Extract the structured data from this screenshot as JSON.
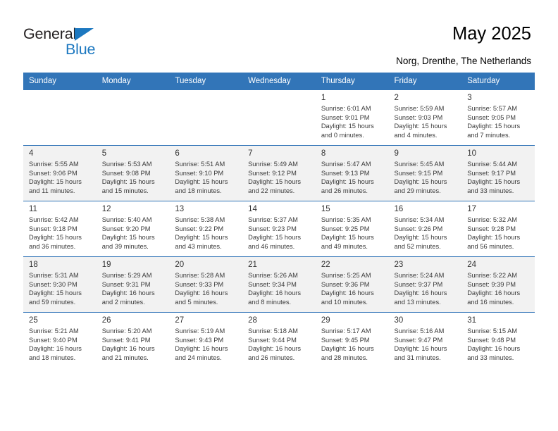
{
  "brand": {
    "name_top": "General",
    "name_bottom": "Blue",
    "accent_color": "#1c78c0"
  },
  "header": {
    "title": "May 2025",
    "subtitle": "Norg, Drenthe, The Netherlands"
  },
  "theme": {
    "header_row_bg": "#3275b8",
    "header_row_text": "#ffffff",
    "alt_row_bg": "#f2f2f2",
    "grid_line": "#3275b8"
  },
  "calendar": {
    "weekday_headers": [
      "Sunday",
      "Monday",
      "Tuesday",
      "Wednesday",
      "Thursday",
      "Friday",
      "Saturday"
    ],
    "weeks": [
      [
        {
          "day": "",
          "sunrise": "",
          "sunset": "",
          "daylight_line1": "",
          "daylight_line2": ""
        },
        {
          "day": "",
          "sunrise": "",
          "sunset": "",
          "daylight_line1": "",
          "daylight_line2": ""
        },
        {
          "day": "",
          "sunrise": "",
          "sunset": "",
          "daylight_line1": "",
          "daylight_line2": ""
        },
        {
          "day": "",
          "sunrise": "",
          "sunset": "",
          "daylight_line1": "",
          "daylight_line2": ""
        },
        {
          "day": "1",
          "sunrise": "Sunrise: 6:01 AM",
          "sunset": "Sunset: 9:01 PM",
          "daylight_line1": "Daylight: 15 hours",
          "daylight_line2": "and 0 minutes."
        },
        {
          "day": "2",
          "sunrise": "Sunrise: 5:59 AM",
          "sunset": "Sunset: 9:03 PM",
          "daylight_line1": "Daylight: 15 hours",
          "daylight_line2": "and 4 minutes."
        },
        {
          "day": "3",
          "sunrise": "Sunrise: 5:57 AM",
          "sunset": "Sunset: 9:05 PM",
          "daylight_line1": "Daylight: 15 hours",
          "daylight_line2": "and 7 minutes."
        }
      ],
      [
        {
          "day": "4",
          "sunrise": "Sunrise: 5:55 AM",
          "sunset": "Sunset: 9:06 PM",
          "daylight_line1": "Daylight: 15 hours",
          "daylight_line2": "and 11 minutes."
        },
        {
          "day": "5",
          "sunrise": "Sunrise: 5:53 AM",
          "sunset": "Sunset: 9:08 PM",
          "daylight_line1": "Daylight: 15 hours",
          "daylight_line2": "and 15 minutes."
        },
        {
          "day": "6",
          "sunrise": "Sunrise: 5:51 AM",
          "sunset": "Sunset: 9:10 PM",
          "daylight_line1": "Daylight: 15 hours",
          "daylight_line2": "and 18 minutes."
        },
        {
          "day": "7",
          "sunrise": "Sunrise: 5:49 AM",
          "sunset": "Sunset: 9:12 PM",
          "daylight_line1": "Daylight: 15 hours",
          "daylight_line2": "and 22 minutes."
        },
        {
          "day": "8",
          "sunrise": "Sunrise: 5:47 AM",
          "sunset": "Sunset: 9:13 PM",
          "daylight_line1": "Daylight: 15 hours",
          "daylight_line2": "and 26 minutes."
        },
        {
          "day": "9",
          "sunrise": "Sunrise: 5:45 AM",
          "sunset": "Sunset: 9:15 PM",
          "daylight_line1": "Daylight: 15 hours",
          "daylight_line2": "and 29 minutes."
        },
        {
          "day": "10",
          "sunrise": "Sunrise: 5:44 AM",
          "sunset": "Sunset: 9:17 PM",
          "daylight_line1": "Daylight: 15 hours",
          "daylight_line2": "and 33 minutes."
        }
      ],
      [
        {
          "day": "11",
          "sunrise": "Sunrise: 5:42 AM",
          "sunset": "Sunset: 9:18 PM",
          "daylight_line1": "Daylight: 15 hours",
          "daylight_line2": "and 36 minutes."
        },
        {
          "day": "12",
          "sunrise": "Sunrise: 5:40 AM",
          "sunset": "Sunset: 9:20 PM",
          "daylight_line1": "Daylight: 15 hours",
          "daylight_line2": "and 39 minutes."
        },
        {
          "day": "13",
          "sunrise": "Sunrise: 5:38 AM",
          "sunset": "Sunset: 9:22 PM",
          "daylight_line1": "Daylight: 15 hours",
          "daylight_line2": "and 43 minutes."
        },
        {
          "day": "14",
          "sunrise": "Sunrise: 5:37 AM",
          "sunset": "Sunset: 9:23 PM",
          "daylight_line1": "Daylight: 15 hours",
          "daylight_line2": "and 46 minutes."
        },
        {
          "day": "15",
          "sunrise": "Sunrise: 5:35 AM",
          "sunset": "Sunset: 9:25 PM",
          "daylight_line1": "Daylight: 15 hours",
          "daylight_line2": "and 49 minutes."
        },
        {
          "day": "16",
          "sunrise": "Sunrise: 5:34 AM",
          "sunset": "Sunset: 9:26 PM",
          "daylight_line1": "Daylight: 15 hours",
          "daylight_line2": "and 52 minutes."
        },
        {
          "day": "17",
          "sunrise": "Sunrise: 5:32 AM",
          "sunset": "Sunset: 9:28 PM",
          "daylight_line1": "Daylight: 15 hours",
          "daylight_line2": "and 56 minutes."
        }
      ],
      [
        {
          "day": "18",
          "sunrise": "Sunrise: 5:31 AM",
          "sunset": "Sunset: 9:30 PM",
          "daylight_line1": "Daylight: 15 hours",
          "daylight_line2": "and 59 minutes."
        },
        {
          "day": "19",
          "sunrise": "Sunrise: 5:29 AM",
          "sunset": "Sunset: 9:31 PM",
          "daylight_line1": "Daylight: 16 hours",
          "daylight_line2": "and 2 minutes."
        },
        {
          "day": "20",
          "sunrise": "Sunrise: 5:28 AM",
          "sunset": "Sunset: 9:33 PM",
          "daylight_line1": "Daylight: 16 hours",
          "daylight_line2": "and 5 minutes."
        },
        {
          "day": "21",
          "sunrise": "Sunrise: 5:26 AM",
          "sunset": "Sunset: 9:34 PM",
          "daylight_line1": "Daylight: 16 hours",
          "daylight_line2": "and 8 minutes."
        },
        {
          "day": "22",
          "sunrise": "Sunrise: 5:25 AM",
          "sunset": "Sunset: 9:36 PM",
          "daylight_line1": "Daylight: 16 hours",
          "daylight_line2": "and 10 minutes."
        },
        {
          "day": "23",
          "sunrise": "Sunrise: 5:24 AM",
          "sunset": "Sunset: 9:37 PM",
          "daylight_line1": "Daylight: 16 hours",
          "daylight_line2": "and 13 minutes."
        },
        {
          "day": "24",
          "sunrise": "Sunrise: 5:22 AM",
          "sunset": "Sunset: 9:39 PM",
          "daylight_line1": "Daylight: 16 hours",
          "daylight_line2": "and 16 minutes."
        }
      ],
      [
        {
          "day": "25",
          "sunrise": "Sunrise: 5:21 AM",
          "sunset": "Sunset: 9:40 PM",
          "daylight_line1": "Daylight: 16 hours",
          "daylight_line2": "and 18 minutes."
        },
        {
          "day": "26",
          "sunrise": "Sunrise: 5:20 AM",
          "sunset": "Sunset: 9:41 PM",
          "daylight_line1": "Daylight: 16 hours",
          "daylight_line2": "and 21 minutes."
        },
        {
          "day": "27",
          "sunrise": "Sunrise: 5:19 AM",
          "sunset": "Sunset: 9:43 PM",
          "daylight_line1": "Daylight: 16 hours",
          "daylight_line2": "and 24 minutes."
        },
        {
          "day": "28",
          "sunrise": "Sunrise: 5:18 AM",
          "sunset": "Sunset: 9:44 PM",
          "daylight_line1": "Daylight: 16 hours",
          "daylight_line2": "and 26 minutes."
        },
        {
          "day": "29",
          "sunrise": "Sunrise: 5:17 AM",
          "sunset": "Sunset: 9:45 PM",
          "daylight_line1": "Daylight: 16 hours",
          "daylight_line2": "and 28 minutes."
        },
        {
          "day": "30",
          "sunrise": "Sunrise: 5:16 AM",
          "sunset": "Sunset: 9:47 PM",
          "daylight_line1": "Daylight: 16 hours",
          "daylight_line2": "and 31 minutes."
        },
        {
          "day": "31",
          "sunrise": "Sunrise: 5:15 AM",
          "sunset": "Sunset: 9:48 PM",
          "daylight_line1": "Daylight: 16 hours",
          "daylight_line2": "and 33 minutes."
        }
      ]
    ]
  }
}
